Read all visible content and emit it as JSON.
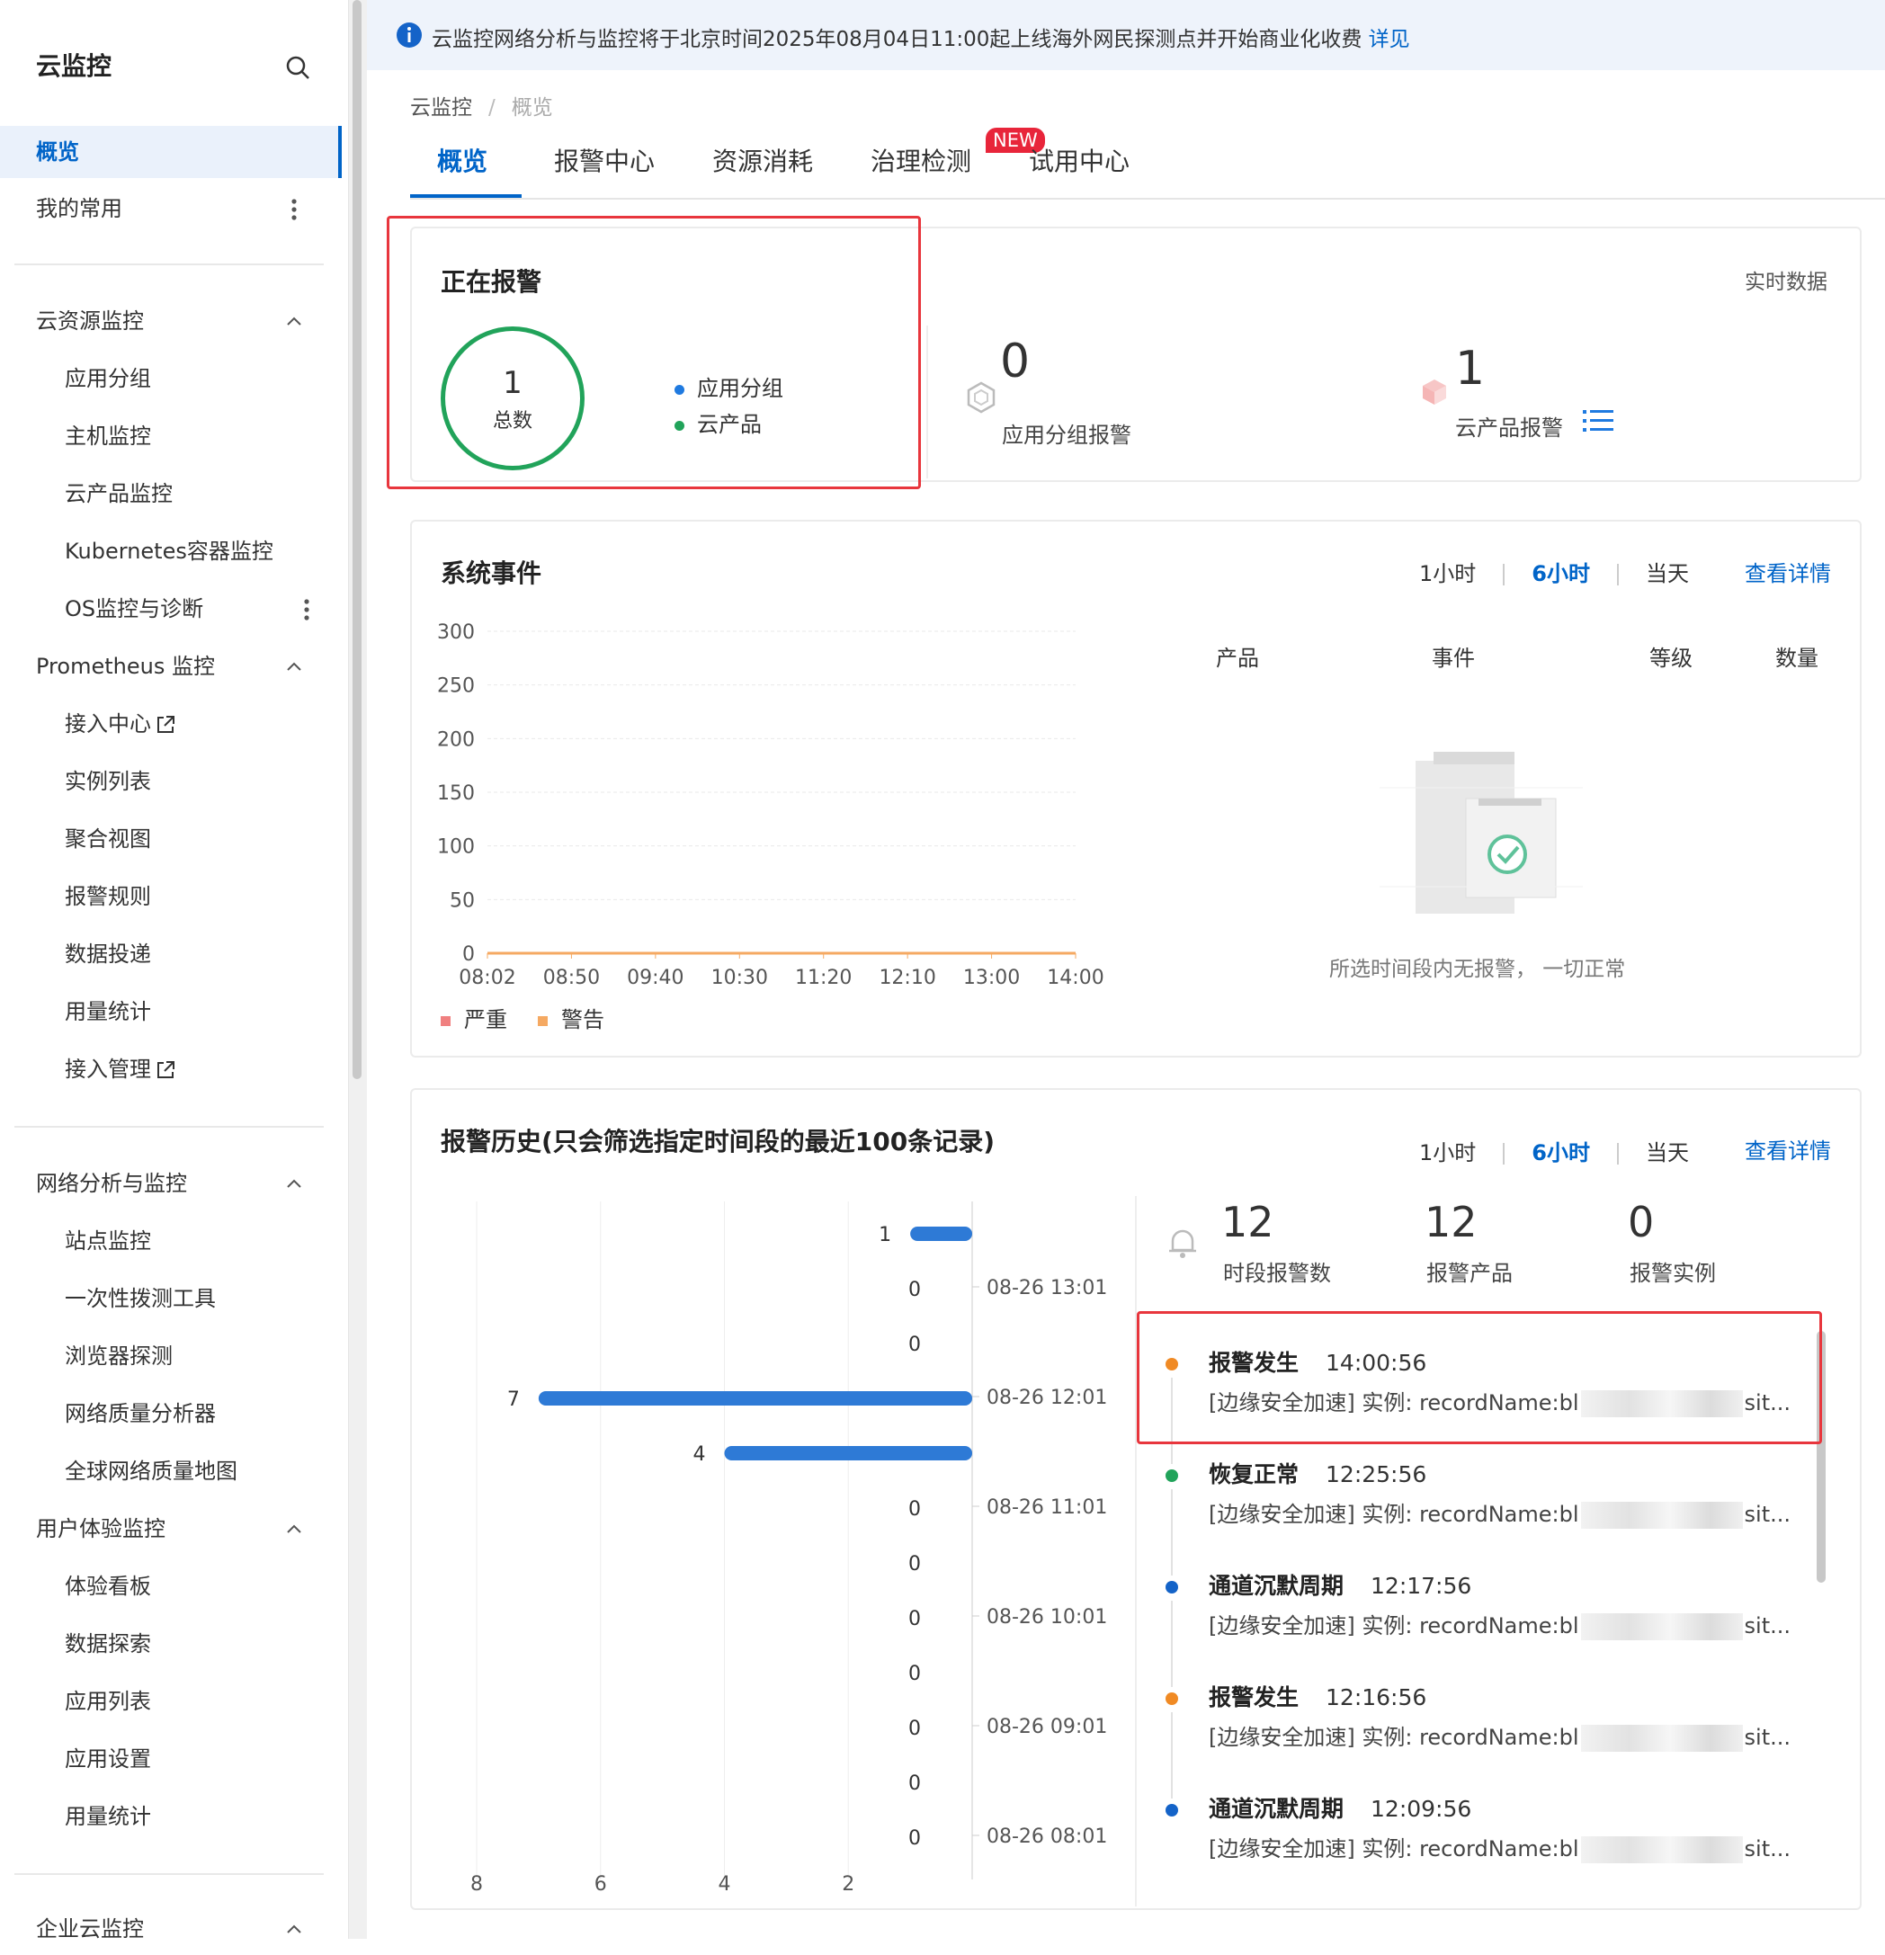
{
  "sidebar": {
    "title": "云监控",
    "items": [
      {
        "label": "概览"
      },
      {
        "label": "我的常用"
      },
      {
        "label": "云资源监控"
      },
      {
        "label": "应用分组"
      },
      {
        "label": "主机监控"
      },
      {
        "label": "云产品监控"
      },
      {
        "label": "Kubernetes容器监控"
      },
      {
        "label": "OS监控与诊断"
      },
      {
        "label": "Prometheus 监控"
      },
      {
        "label": "接入中心"
      },
      {
        "label": "实例列表"
      },
      {
        "label": "聚合视图"
      },
      {
        "label": "报警规则"
      },
      {
        "label": "数据投递"
      },
      {
        "label": "用量统计"
      },
      {
        "label": "接入管理"
      },
      {
        "label": "网络分析与监控"
      },
      {
        "label": "站点监控"
      },
      {
        "label": "一次性拨测工具"
      },
      {
        "label": "浏览器探测"
      },
      {
        "label": "网络质量分析器"
      },
      {
        "label": "全球网络质量地图"
      },
      {
        "label": "用户体验监控"
      },
      {
        "label": "体验看板"
      },
      {
        "label": "数据探索"
      },
      {
        "label": "应用列表"
      },
      {
        "label": "应用设置"
      },
      {
        "label": "用量统计"
      },
      {
        "label": "企业云监控"
      }
    ]
  },
  "banner": {
    "text": "云监控网络分析与监控将于北京时间2025年08月04日11:00起上线海外网民探测点并开始商业化收费",
    "link": "详见"
  },
  "breadcrumb": {
    "root": "云监控",
    "sep": "/",
    "current": "概览"
  },
  "tabs": [
    {
      "label": "概览"
    },
    {
      "label": "报警中心"
    },
    {
      "label": "资源消耗"
    },
    {
      "label": "治理检测"
    },
    {
      "label": "试用中心"
    }
  ],
  "new_badge": "NEW",
  "alarm_card": {
    "title": "正在报警",
    "realtime": "实时数据",
    "total": "1",
    "total_label": "总数",
    "legend": [
      {
        "label": "应用分组",
        "color": "#1f7ae0"
      },
      {
        "label": "云产品",
        "color": "#21a35a"
      }
    ],
    "app_group_count": "0",
    "app_group_label": "应用分组报警",
    "cloud_product_count": "1",
    "cloud_product_label": "云产品报警"
  },
  "events_card": {
    "title": "系统事件",
    "ranges": [
      "1小时",
      "6小时",
      "当天"
    ],
    "detail": "查看详情",
    "table_headers": [
      "产品",
      "事件",
      "等级",
      "数量"
    ],
    "empty_text": "所选时间段内无报警， 一切正常",
    "legend": [
      {
        "label": "严重",
        "color": "#f08080"
      },
      {
        "label": "警告",
        "color": "#f5a962"
      }
    ]
  },
  "history_card": {
    "title": "报警历史(只会筛选指定时间段的最近100条记录)",
    "ranges": [
      "1小时",
      "6小时",
      "当天"
    ],
    "detail": "查看详情",
    "stats": [
      {
        "value": "12",
        "label": "时段报警数"
      },
      {
        "value": "12",
        "label": "报警产品"
      },
      {
        "value": "0",
        "label": "报警实例"
      }
    ],
    "timeline": [
      {
        "title": "报警发生",
        "time": "14:00:56",
        "desc_prefix": "[边缘安全加速] 实例: recordName:bl",
        "desc_suffix": "sit...",
        "color": "#f08a24"
      },
      {
        "title": "恢复正常",
        "time": "12:25:56",
        "desc_prefix": "[边缘安全加速] 实例: recordName:bl",
        "desc_suffix": "sit...",
        "color": "#21a35a"
      },
      {
        "title": "通道沉默周期",
        "time": "12:17:56",
        "desc_prefix": "[边缘安全加速] 实例: recordName:bl",
        "desc_suffix": "sit...",
        "color": "#1463c8"
      },
      {
        "title": "报警发生",
        "time": "12:16:56",
        "desc_prefix": "[边缘安全加速] 实例: recordName:bl",
        "desc_suffix": "sit...",
        "color": "#f08a24"
      },
      {
        "title": "通道沉默周期",
        "time": "12:09:56",
        "desc_prefix": "[边缘安全加速] 实例: recordName:bl",
        "desc_suffix": "sit...",
        "color": "#1463c8"
      }
    ]
  },
  "chart_data": [
    {
      "type": "line",
      "title": "系统事件",
      "x": [
        "08:02",
        "08:50",
        "09:40",
        "10:30",
        "11:20",
        "12:10",
        "13:00",
        "14:00"
      ],
      "ylim": [
        0,
        300
      ],
      "yticks": [
        0,
        50,
        100,
        150,
        200,
        250,
        300
      ],
      "series": [
        {
          "name": "严重",
          "color": "#f08080",
          "values": [
            0,
            0,
            0,
            0,
            0,
            0,
            0,
            0
          ]
        },
        {
          "name": "警告",
          "color": "#f5a962",
          "values": [
            0,
            0,
            0,
            0,
            0,
            0,
            0,
            0
          ]
        }
      ],
      "grid": true,
      "legend": "bottom-left"
    },
    {
      "type": "bar",
      "orientation": "horizontal",
      "direction": "right-to-left",
      "values": [
        1,
        0,
        0,
        7,
        4,
        0,
        0,
        0,
        0,
        0,
        0,
        0
      ],
      "time_labels": [
        "08-26 13:01",
        "08-26 12:01",
        "08-26 11:01",
        "08-26 10:01",
        "08-26 09:01",
        "08-26 08:01"
      ],
      "xticks": [
        8,
        6,
        4,
        2
      ],
      "xlim": [
        0,
        8
      ],
      "color": "#2e7ad6",
      "grid": true
    }
  ]
}
